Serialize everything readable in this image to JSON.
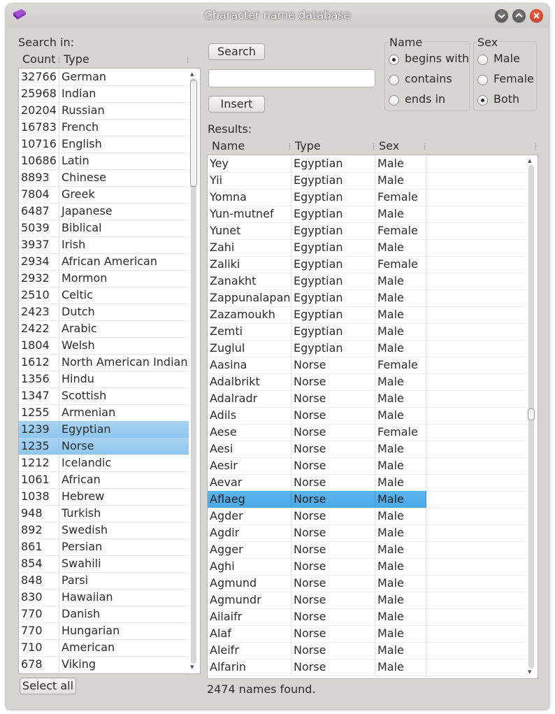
{
  "window": {
    "title": "Character name database"
  },
  "left": {
    "search_in_label": "Search in:",
    "columns": [
      "Count",
      "Type"
    ],
    "rows": [
      {
        "count": "32766",
        "type": "German"
      },
      {
        "count": "25968",
        "type": "Indian"
      },
      {
        "count": "20204",
        "type": "Russian"
      },
      {
        "count": "16783",
        "type": "French"
      },
      {
        "count": "10716",
        "type": "English"
      },
      {
        "count": "10686",
        "type": "Latin"
      },
      {
        "count": "8893",
        "type": "Chinese"
      },
      {
        "count": "7804",
        "type": "Greek"
      },
      {
        "count": "6487",
        "type": "Japanese"
      },
      {
        "count": "5039",
        "type": "Biblical"
      },
      {
        "count": "3937",
        "type": "Irish"
      },
      {
        "count": "2934",
        "type": "African American"
      },
      {
        "count": "2932",
        "type": "Mormon"
      },
      {
        "count": "2510",
        "type": "Celtic"
      },
      {
        "count": "2423",
        "type": "Dutch"
      },
      {
        "count": "2422",
        "type": "Arabic"
      },
      {
        "count": "1804",
        "type": "Welsh"
      },
      {
        "count": "1612",
        "type": "North American Indian"
      },
      {
        "count": "1356",
        "type": "Hindu"
      },
      {
        "count": "1347",
        "type": "Scottish"
      },
      {
        "count": "1255",
        "type": "Armenian"
      },
      {
        "count": "1239",
        "type": "Egyptian",
        "selected": true
      },
      {
        "count": "1235",
        "type": "Norse",
        "selected": true
      },
      {
        "count": "1212",
        "type": "Icelandic"
      },
      {
        "count": "1061",
        "type": "African"
      },
      {
        "count": "1038",
        "type": "Hebrew"
      },
      {
        "count": "948",
        "type": "Turkish"
      },
      {
        "count": "892",
        "type": "Swedish"
      },
      {
        "count": "861",
        "type": "Persian"
      },
      {
        "count": "854",
        "type": "Swahili"
      },
      {
        "count": "848",
        "type": "Parsi"
      },
      {
        "count": "830",
        "type": "Hawaiian"
      },
      {
        "count": "770",
        "type": "Danish"
      },
      {
        "count": "770",
        "type": "Hungarian"
      },
      {
        "count": "710",
        "type": "American"
      },
      {
        "count": "678",
        "type": "Viking"
      }
    ],
    "select_all_label": "Select all"
  },
  "controls": {
    "search_label": "Search",
    "search_value": "",
    "insert_label": "Insert",
    "name_group": {
      "title": "Name",
      "options": [
        {
          "label": "begins with",
          "checked": true
        },
        {
          "label": "contains",
          "checked": false
        },
        {
          "label": "ends in",
          "checked": false
        }
      ]
    },
    "sex_group": {
      "title": "Sex",
      "options": [
        {
          "label": "Male",
          "checked": false
        },
        {
          "label": "Female",
          "checked": false
        },
        {
          "label": "Both",
          "checked": true
        }
      ]
    }
  },
  "results": {
    "label": "Results:",
    "columns": [
      "Name",
      "Type",
      "Sex"
    ],
    "rows": [
      {
        "name": "Yey",
        "type": "Egyptian",
        "sex": "Male"
      },
      {
        "name": "Yii",
        "type": "Egyptian",
        "sex": "Male"
      },
      {
        "name": "Yomna",
        "type": "Egyptian",
        "sex": "Female"
      },
      {
        "name": "Yun-mutnef",
        "type": "Egyptian",
        "sex": "Male"
      },
      {
        "name": "Yunet",
        "type": "Egyptian",
        "sex": "Female"
      },
      {
        "name": "Zahi",
        "type": "Egyptian",
        "sex": "Male"
      },
      {
        "name": "Zaliki",
        "type": "Egyptian",
        "sex": "Female"
      },
      {
        "name": "Zanakht",
        "type": "Egyptian",
        "sex": "Male"
      },
      {
        "name": "Zappunalapan",
        "type": "Egyptian",
        "sex": "Male"
      },
      {
        "name": "Zazamoukh",
        "type": "Egyptian",
        "sex": "Male"
      },
      {
        "name": "Zemti",
        "type": "Egyptian",
        "sex": "Male"
      },
      {
        "name": "Zuglul",
        "type": "Egyptian",
        "sex": "Male"
      },
      {
        "name": "Aasina",
        "type": "Norse",
        "sex": "Female"
      },
      {
        "name": "Adalbrikt",
        "type": "Norse",
        "sex": "Male"
      },
      {
        "name": "Adalradr",
        "type": "Norse",
        "sex": "Male"
      },
      {
        "name": "Adils",
        "type": "Norse",
        "sex": "Male"
      },
      {
        "name": "Aese",
        "type": "Norse",
        "sex": "Female"
      },
      {
        "name": "Aesi",
        "type": "Norse",
        "sex": "Male"
      },
      {
        "name": "Aesir",
        "type": "Norse",
        "sex": "Male"
      },
      {
        "name": "Aevar",
        "type": "Norse",
        "sex": "Male"
      },
      {
        "name": "Aflaeg",
        "type": "Norse",
        "sex": "Male",
        "selected": true
      },
      {
        "name": "Agder",
        "type": "Norse",
        "sex": "Male"
      },
      {
        "name": "Agdir",
        "type": "Norse",
        "sex": "Male"
      },
      {
        "name": "Agger",
        "type": "Norse",
        "sex": "Male"
      },
      {
        "name": "Aghi",
        "type": "Norse",
        "sex": "Male"
      },
      {
        "name": "Agmund",
        "type": "Norse",
        "sex": "Male"
      },
      {
        "name": "Agmundr",
        "type": "Norse",
        "sex": "Male"
      },
      {
        "name": "Ailaifr",
        "type": "Norse",
        "sex": "Male"
      },
      {
        "name": "Alaf",
        "type": "Norse",
        "sex": "Male"
      },
      {
        "name": "Aleifr",
        "type": "Norse",
        "sex": "Male"
      },
      {
        "name": "Alfarin",
        "type": "Norse",
        "sex": "Male"
      }
    ],
    "status": "2474 names found."
  },
  "colors": {
    "selection_left": "#9ccbf0",
    "selection_right": "#4aa8e6",
    "close_button": "#e04a2e"
  }
}
